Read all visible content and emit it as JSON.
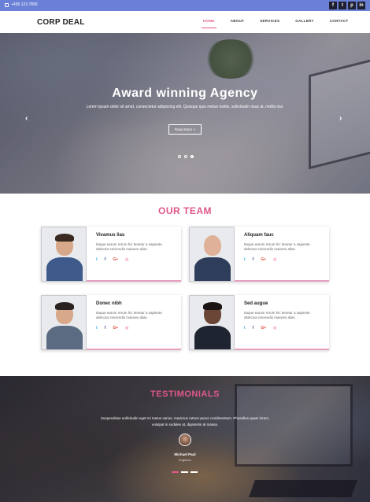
{
  "topbar": {
    "phone": "+456 123 7890",
    "socials": [
      "f",
      "t",
      "p",
      "in"
    ],
    "social_icons": [
      "facebook-icon",
      "twitter-icon",
      "pinterest-icon",
      "linkedin-icon"
    ]
  },
  "nav": {
    "logo": "CORP DEAL",
    "items": [
      "HOME",
      "ABOUT",
      "SERVICES",
      "GALLERY",
      "CONTACT"
    ],
    "active": "HOME"
  },
  "hero": {
    "title": "Award winning Agency",
    "subtitle": "Lorem ipsum dolor sit amet, consectetur adipiscing elit. Quisque quis metus mollis, sollicitudin risus at, mollis nisi.",
    "button": "Read More »",
    "prev": "‹",
    "next": "›"
  },
  "team": {
    "title": "OUR TEAM",
    "members": [
      {
        "name": "Vivamus lias",
        "desc": "Itaque earum rerum hic tenetur a sapiente delectus reiciendis maiores alias"
      },
      {
        "name": "Aliquam fauc",
        "desc": "Itaque earum rerum hic tenetur a sapiente delectus reiciendis maiores alias"
      },
      {
        "name": "Donec nibh",
        "desc": "Itaque earum rerum hic tenetur a sapiente delectus reiciendis maiores alias"
      },
      {
        "name": "Sed augue",
        "desc": "Itaque earum rerum hic tenetur a sapiente delectus reiciendis maiores alias"
      }
    ],
    "social": {
      "twitter": "t",
      "facebook": "f",
      "google": "G+",
      "dribbble": "◎"
    }
  },
  "testimonials": {
    "title": "TESTIMONIALS",
    "text": "Suspendisse sollicitudin eget mi metus varius, maximus rutrum purus condimentum. Phasellus quam lorem, volutpat in sodales at, dignissim at massa.",
    "name": "Michael Paul",
    "role": "Engineer"
  },
  "colors": {
    "accent": "#e0578b",
    "topbar": "#6a7fd6"
  }
}
